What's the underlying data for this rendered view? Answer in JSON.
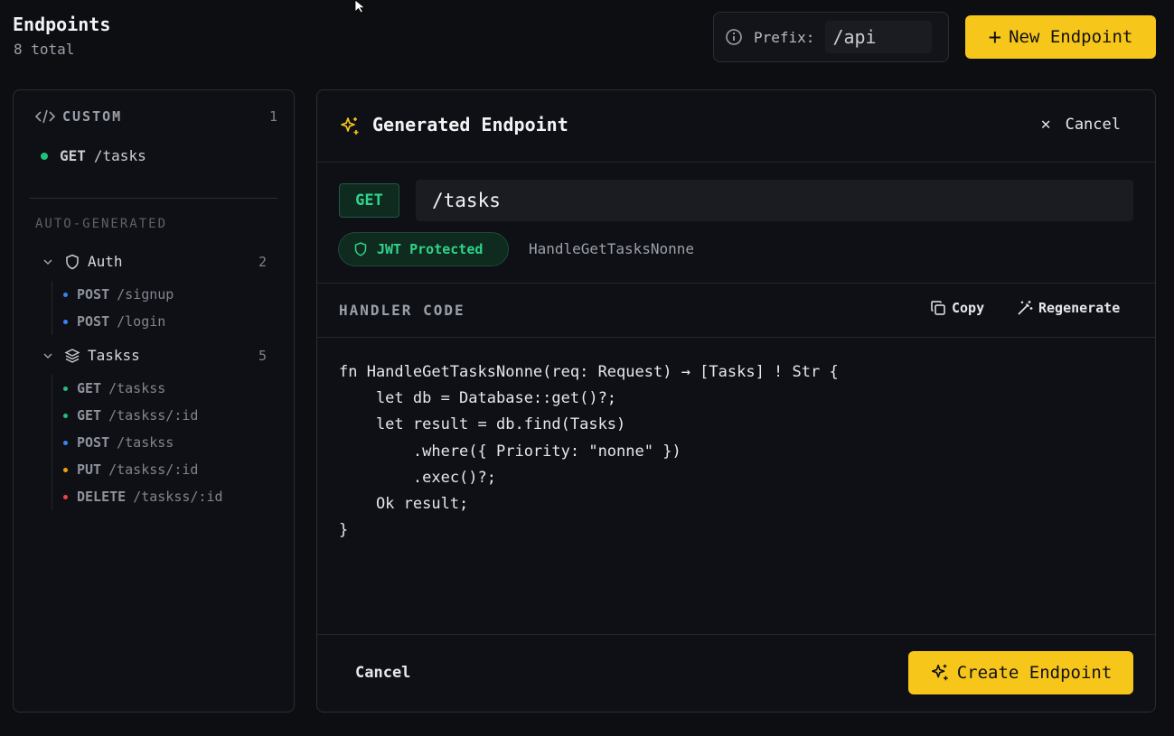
{
  "header": {
    "title": "Endpoints",
    "subtitle": "8 total",
    "prefix_label": "Prefix:",
    "prefix_value": "/api",
    "new_button": "New Endpoint"
  },
  "sidebar": {
    "custom_label": "CUSTOM",
    "custom_count": "1",
    "custom_items": [
      {
        "method": "GET",
        "path": "/tasks",
        "color": "#22c07a"
      }
    ],
    "auto_label": "AUTO-GENERATED",
    "groups": [
      {
        "name": "Auth",
        "count": "2",
        "icon": "shield-icon",
        "items": [
          {
            "method": "POST",
            "path": "/signup",
            "color": "#3b82f6"
          },
          {
            "method": "POST",
            "path": "/login",
            "color": "#3b82f6"
          }
        ]
      },
      {
        "name": "Taskss",
        "count": "5",
        "icon": "layers-icon",
        "items": [
          {
            "method": "GET",
            "path": "/taskss",
            "color": "#22c07a"
          },
          {
            "method": "GET",
            "path": "/taskss/:id",
            "color": "#22c07a"
          },
          {
            "method": "POST",
            "path": "/taskss",
            "color": "#3b82f6"
          },
          {
            "method": "PUT",
            "path": "/taskss/:id",
            "color": "#f59e0b"
          },
          {
            "method": "DELETE",
            "path": "/taskss/:id",
            "color": "#ef4444"
          }
        ]
      }
    ]
  },
  "panel": {
    "title": "Generated Endpoint",
    "cancel_top": "Cancel",
    "method": "GET",
    "path": "/tasks",
    "auth_badge": "JWT Protected",
    "handler_name": "HandleGetTasksNonne",
    "code_label": "HANDLER CODE",
    "copy_label": "Copy",
    "regenerate_label": "Regenerate",
    "code": "fn HandleGetTasksNonne(req: Request) → [Tasks] ! Str {\n    let db = Database::get()?;\n    let result = db.find(Tasks)\n        .where({ Priority: \"nonne\" })\n        .exec()?;\n    Ok result;\n}",
    "cancel_bottom": "Cancel",
    "create_label": "Create Endpoint"
  },
  "colors": {
    "accent": "#f7c61b",
    "get": "#22c07a",
    "post": "#3b82f6",
    "put": "#f59e0b",
    "delete": "#ef4444"
  }
}
